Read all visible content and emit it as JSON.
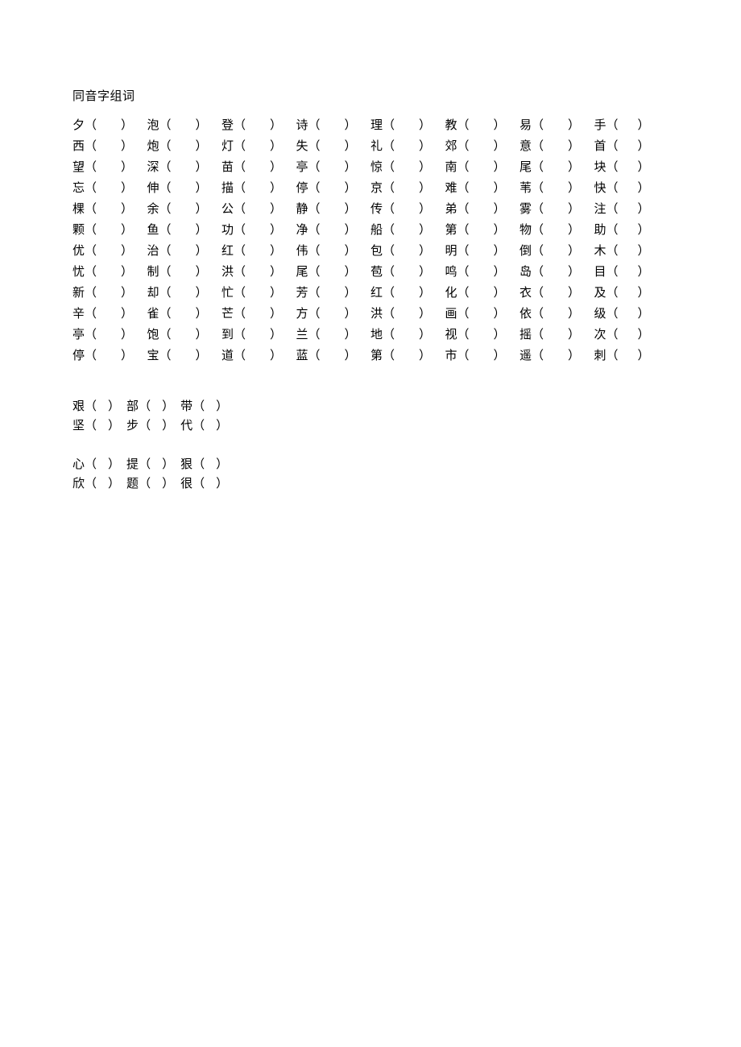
{
  "title": "同音字组词",
  "grid": [
    [
      "夕",
      "泡",
      "登",
      "诗",
      "理",
      "教",
      "易",
      "手"
    ],
    [
      "西",
      "炮",
      "灯",
      "失",
      "礼",
      "郊",
      "意",
      "首"
    ],
    [
      "望",
      "深",
      "苗",
      "亭",
      "惊",
      "南",
      "尾",
      "块"
    ],
    [
      "忘",
      "伸",
      "描",
      "停",
      "京",
      "难",
      "苇",
      "快"
    ],
    [
      "棵",
      "余",
      "公",
      "静",
      "传",
      "弟",
      "雾",
      "注"
    ],
    [
      "颗",
      "鱼",
      "功",
      "净",
      "船",
      "第",
      "物",
      "助"
    ],
    [
      "优",
      "治",
      "红",
      "伟",
      "包",
      "明",
      "倒",
      "木"
    ],
    [
      "忧",
      "制",
      "洪",
      "尾",
      "苞",
      "鸣",
      "岛",
      "目"
    ],
    [
      "新",
      "却",
      "忙",
      "芳",
      "红",
      "化",
      "衣",
      "及"
    ],
    [
      "辛",
      "雀",
      "芒",
      "方",
      "洪",
      "画",
      "依",
      "级"
    ],
    [
      "亭",
      "饱",
      "到",
      "兰",
      "地",
      "视",
      "摇",
      "次"
    ],
    [
      "停",
      "宝",
      "道",
      "蓝",
      "第",
      "市",
      "遥",
      "刺"
    ]
  ],
  "open": "（",
  "close": "）",
  "bottomGroups": [
    [
      [
        "艰",
        "部",
        "带"
      ],
      [
        "坚",
        "步",
        "代"
      ]
    ],
    [
      [
        "心",
        "提",
        "狠"
      ],
      [
        "欣",
        "题",
        "很"
      ]
    ]
  ]
}
